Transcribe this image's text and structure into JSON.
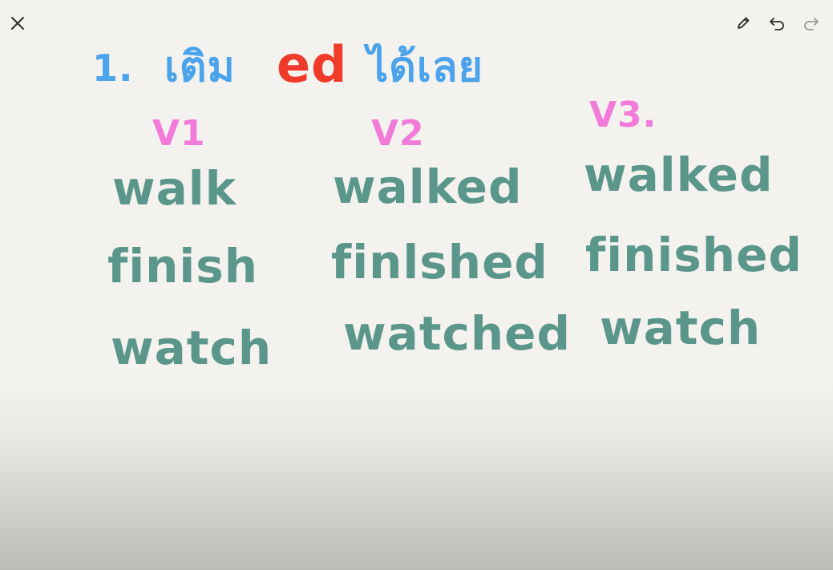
{
  "toolbar": {
    "close_icon": "close-icon",
    "pen_icon": "pencil-icon",
    "undo_icon": "undo-icon",
    "redo_icon": "redo-icon"
  },
  "colors": {
    "blue_ink": "#4ba3eb",
    "red_ink": "#f03a2a",
    "pink_ink": "#f27ad8",
    "teal_ink": "#5a968a",
    "icon_dark": "#2b2b2b",
    "icon_disabled": "#9a9a9a"
  },
  "title": {
    "number": "1.",
    "thai_part1": "เติม",
    "ed": "ed",
    "thai_part2": "ได้เลย"
  },
  "columns": {
    "v1": "V1",
    "v2": "V2",
    "v3": "V3."
  },
  "rows": [
    {
      "v1": "walk",
      "v2": "walked",
      "v3": "walked"
    },
    {
      "v1": "finish",
      "v2": "finlshed",
      "v3": "finished"
    },
    {
      "v1": "watch",
      "v2": "watched",
      "v3": "watch"
    }
  ]
}
